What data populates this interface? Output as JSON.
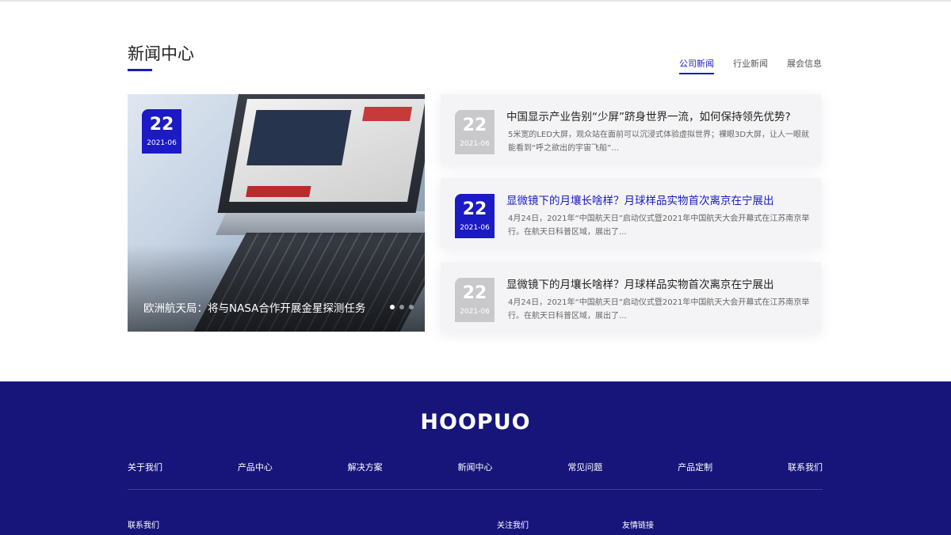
{
  "news_section": {
    "title": "新闻中心",
    "tabs": [
      {
        "label": "公司新闻",
        "active": true
      },
      {
        "label": "行业新闻",
        "active": false
      },
      {
        "label": "展会信息",
        "active": false
      }
    ]
  },
  "featured": {
    "day": "22",
    "year_month": "2021-06",
    "caption": "欧洲航天局：将与NASA合作开展金星探测任务",
    "slide_count": 3,
    "active_slide": 1
  },
  "news_list": [
    {
      "day": "22",
      "year_month": "2021-06",
      "title": "中国显示产业告别“少屏”跻身世界一流，如何保持领先优势?",
      "summary": "5米宽的LED大屏，观众站在面前可以沉浸式体验虚拟世界；裸眼3D大屏，让人一眼就能看到“呼之欲出的宇宙飞船”...",
      "highlight": false
    },
    {
      "day": "22",
      "year_month": "2021-06",
      "title": "显微镜下的月壤长啥样？月球样品实物首次离京在宁展出",
      "summary": "4月24日，2021年“中国航天日”启动仪式暨2021年中国航天大会开幕式在江苏南京举行。在航天日科普区域，展出了...",
      "highlight": true
    },
    {
      "day": "22",
      "year_month": "2021-06",
      "title": "显微镜下的月壤长啥样？月球样品实物首次离京在宁展出",
      "summary": "4月24日，2021年“中国航天日”启动仪式暨2021年中国航天大会开幕式在江苏南京举行。在航天日科普区域，展出了...",
      "highlight": false
    }
  ],
  "footer": {
    "logo": "HOOPUO",
    "nav": [
      "关于我们",
      "产品中心",
      "解决方案",
      "新闻中心",
      "常见问题",
      "产品定制",
      "联系我们"
    ],
    "columns": [
      "联系我们",
      "关注我们",
      "友情链接"
    ]
  },
  "colors": {
    "accent": "#1b1ac4",
    "footer_bg": "#17157a",
    "badge_inactive": "#c9c9cc",
    "card_bg": "#f4f4f6"
  }
}
